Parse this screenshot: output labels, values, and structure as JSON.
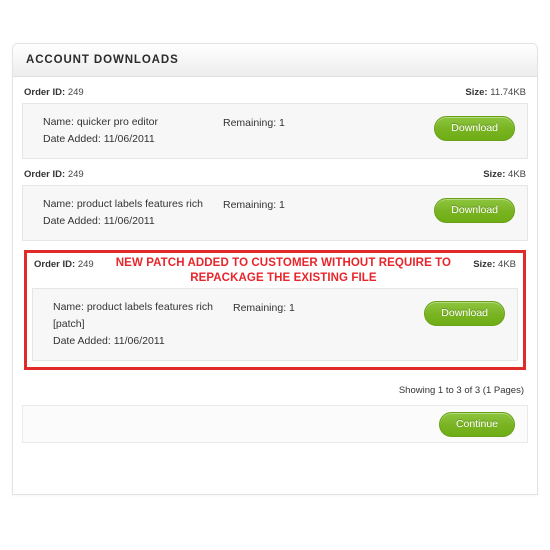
{
  "panel": {
    "title": "ACCOUNT DOWNLOADS"
  },
  "labels": {
    "order_id_label": "Order ID:",
    "size_label": "Size:",
    "download_button": "Download",
    "continue_button": "Continue"
  },
  "downloads": [
    {
      "order_id": "249",
      "size": "11.74KB",
      "name": "Name: quicker pro editor",
      "date_added": "Date Added: 11/06/2011",
      "remaining": "Remaining: 1",
      "button": "Download"
    },
    {
      "order_id": "249",
      "size": "4KB",
      "name": "Name: product labels features rich",
      "date_added": "Date Added: 11/06/2011",
      "remaining": "Remaining: 1",
      "button": "Download"
    },
    {
      "order_id": "249",
      "size": "4KB",
      "name": "Name: product labels features rich [patch]",
      "date_added": "Date Added: 11/06/2011",
      "remaining": "Remaining: 1",
      "button": "Download",
      "annotation": "NEW PATCH ADDED TO CUSTOMER WITHOUT REQUIRE TO REPACKAGE THE EXISTING FILE"
    }
  ],
  "pagination": {
    "showing": "Showing 1 to 3 of 3 (1 Pages)"
  },
  "footer": {
    "continue": "Continue"
  },
  "colors": {
    "accent_green": "#79b321",
    "annotation_red": "#e8252b",
    "highlight_border": "#e02b2b",
    "panel_border": "#e3e3e3",
    "row_bg": "#f7f7f7"
  }
}
